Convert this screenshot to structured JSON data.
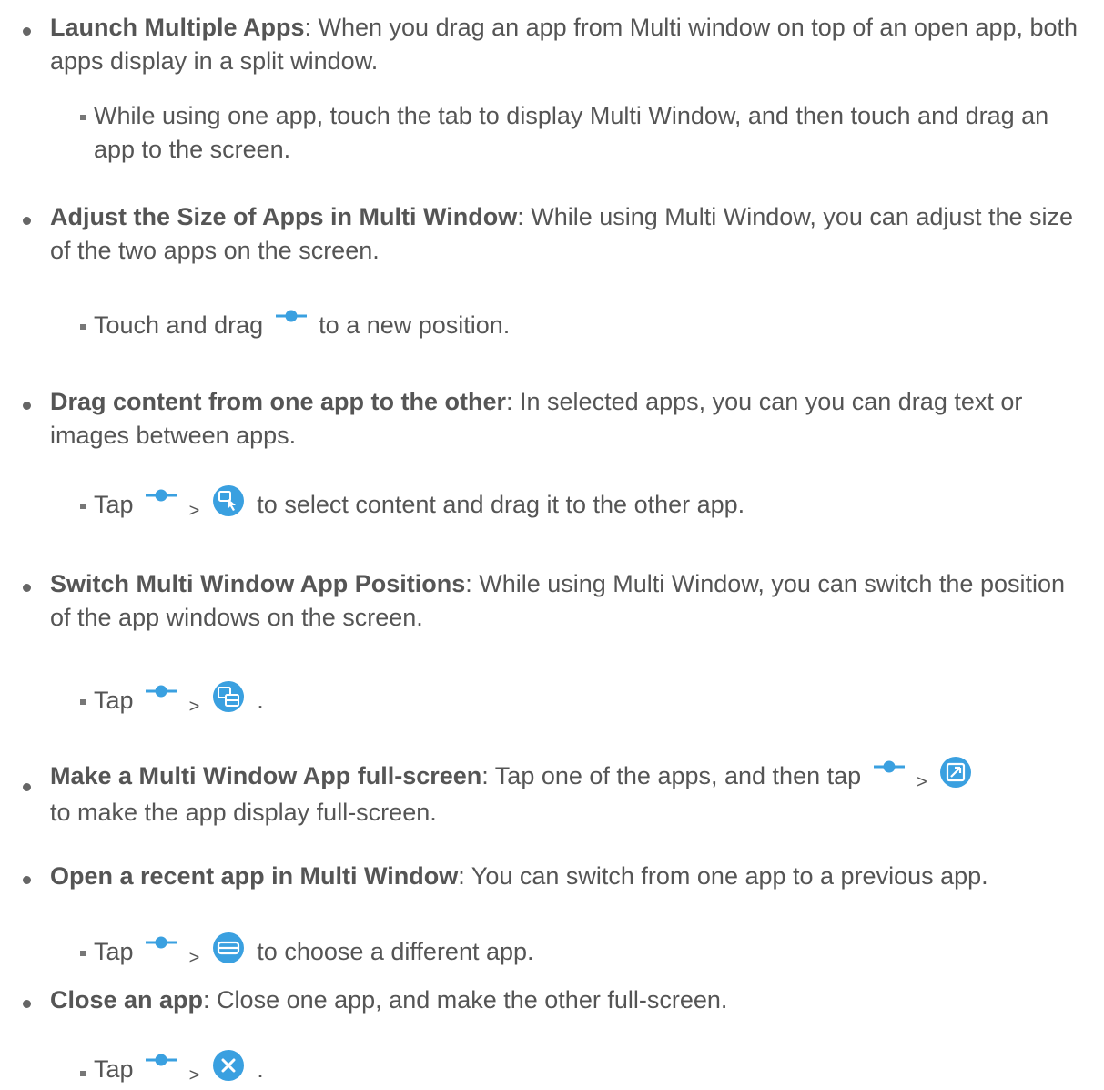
{
  "items": [
    {
      "title": "Launch Multiple Apps",
      "desc": ": When you drag an app from Multi window on top of an open app, both apps display in a split window.",
      "sub": "While using one app, touch the tab to display Multi Window, and then touch and drag an app to the screen."
    },
    {
      "title": "Adjust the Size of Apps in Multi Window",
      "desc": ": While using Multi Window, you can adjust the size of the two apps on the screen.",
      "sub_pre": "Touch and drag",
      "sub_post": "to a new position."
    },
    {
      "title": "Drag content from one app to the other",
      "desc": ": In selected apps, you can you can drag text or images between apps.",
      "sub_pre": "Tap",
      "sub_post": "to select content and drag it to the other app."
    },
    {
      "title": "Switch Multi Window App Positions",
      "desc": ": While using Multi Window, you can switch the position of the app windows on the screen.",
      "sub_pre": "Tap",
      "sub_post": "."
    },
    {
      "title": "Make a Multi Window App full-screen",
      "desc": ": Tap one of the apps, and then tap",
      "desc_post": "to make the app display full-screen."
    },
    {
      "title": "Open a recent app in Multi Window",
      "desc": ": You can switch from one app to a previous app.",
      "sub_pre": "Tap",
      "sub_post": "to choose a different app."
    },
    {
      "title": "Close an app",
      "desc": ": Close one app, and make the other full-screen.",
      "sub_pre": "Tap",
      "sub_post": "."
    }
  ],
  "gt_symbol": ">",
  "icons": {
    "handle": "window-handle-icon",
    "drag_content": "drag-content-icon",
    "switch_windows": "switch-windows-icon",
    "full_screen": "full-screen-icon",
    "recent_apps": "recent-apps-icon",
    "close": "close-icon"
  },
  "colors": {
    "text": "#555555",
    "icon_blue": "#3aa0e0"
  }
}
